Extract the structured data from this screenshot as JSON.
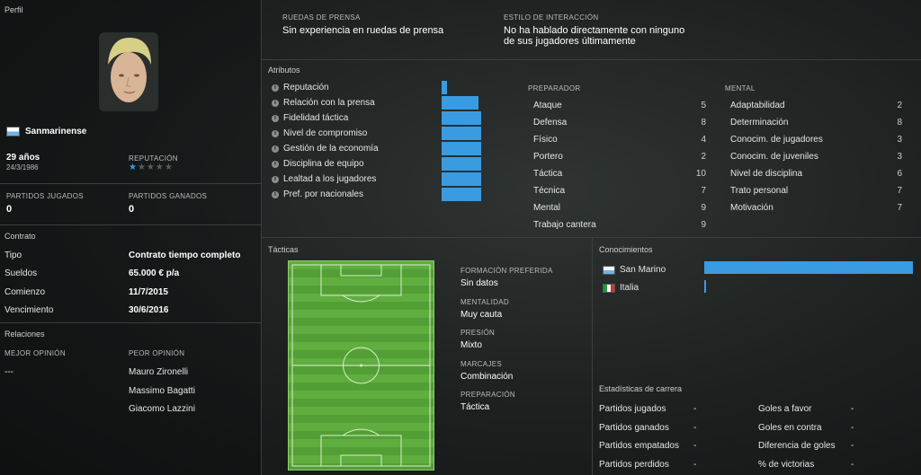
{
  "profile": {
    "section_title": "Perfil",
    "nationality": "Sanmarinense",
    "age": "29 años",
    "birth_date": "24/3/1986",
    "reputation_label": "REPUTACIÓN",
    "reputation_stars": 0.5,
    "reputation_stars_max": 5,
    "games_played_label": "PARTIDOS JUGADOS",
    "games_played": "0",
    "games_won_label": "PARTIDOS GANADOS",
    "games_won": "0"
  },
  "contract": {
    "section_title": "Contrato",
    "rows": [
      {
        "label": "Tipo",
        "value": "Contrato tiempo completo"
      },
      {
        "label": "Sueldos",
        "value": "65.000 € p/a"
      },
      {
        "label": "Comienzo",
        "value": "11/7/2015"
      },
      {
        "label": "Vencimiento",
        "value": "30/6/2016"
      }
    ]
  },
  "relations": {
    "section_title": "Relaciones",
    "best_label": "MEJOR OPINIÓN",
    "best_value": "---",
    "worst_label": "PEOR OPINIÓN",
    "worst": [
      "Mauro Zironelli",
      "Massimo Bagatti",
      "Giacomo Lazzini"
    ]
  },
  "press": {
    "label": "RUEDAS DE PRENSA",
    "value": "Sin experiencia en ruedas de prensa",
    "interaction_label": "ESTILO DE INTERACCIÓN",
    "interaction_value_line1": "No ha hablado directamente con ninguno",
    "interaction_value_line2": "de sus jugadores últimamente"
  },
  "attributes": {
    "section_title": "Atributos",
    "items": [
      {
        "label": "Reputación",
        "level": 0.12
      },
      {
        "label": "Relación con la prensa",
        "level": 0.9
      },
      {
        "label": "Fidelidad táctica",
        "level": 0.95
      },
      {
        "label": "Nivel de compromiso",
        "level": 0.95
      },
      {
        "label": "Gestión de la economía",
        "level": 0.95
      },
      {
        "label": "Disciplina de equipo",
        "level": 0.95
      },
      {
        "label": "Lealtad a los jugadores",
        "level": 0.95
      },
      {
        "label": "Pref. por nacionales",
        "level": 0.95
      }
    ]
  },
  "coach": {
    "title": "PREPARADOR",
    "rows": [
      {
        "label": "Ataque",
        "value": "5"
      },
      {
        "label": "Defensa",
        "value": "8"
      },
      {
        "label": "Físico",
        "value": "4"
      },
      {
        "label": "Portero",
        "value": "2"
      },
      {
        "label": "Táctica",
        "value": "10"
      },
      {
        "label": "Técnica",
        "value": "7"
      },
      {
        "label": "Mental",
        "value": "9"
      },
      {
        "label": "Trabajo cantera",
        "value": "9"
      }
    ]
  },
  "mental": {
    "title": "MENTAL",
    "rows": [
      {
        "label": "Adaptabilidad",
        "value": "2"
      },
      {
        "label": "Determinación",
        "value": "8"
      },
      {
        "label": "Conocim. de jugadores",
        "value": "3"
      },
      {
        "label": "Conocim. de juveniles",
        "value": "3"
      },
      {
        "label": "Nivel de disciplina",
        "value": "6"
      },
      {
        "label": "Trato personal",
        "value": "7"
      },
      {
        "label": "Motivación",
        "value": "7"
      }
    ]
  },
  "tactics": {
    "section_title": "Tácticas",
    "items": [
      {
        "label": "FORMACIÓN PREFERIDA",
        "value": "Sin datos"
      },
      {
        "label": "MENTALIDAD",
        "value": "Muy cauta"
      },
      {
        "label": "PRESIÓN",
        "value": "Mixto"
      },
      {
        "label": "MARCAJES",
        "value": "Combinación"
      },
      {
        "label": "PREPARACIÓN",
        "value": "Táctica"
      }
    ]
  },
  "knowledge": {
    "section_title": "Conocimientos",
    "items": [
      {
        "country": "San Marino",
        "level": 1.0
      },
      {
        "country": "Italia",
        "level": 0.01
      }
    ]
  },
  "career": {
    "section_title": "Estadísticas de carrera",
    "left": [
      {
        "label": "Partidos jugados",
        "value": "-"
      },
      {
        "label": "Partidos ganados",
        "value": "-"
      },
      {
        "label": "Partidos empatados",
        "value": "-"
      },
      {
        "label": "Partidos perdidos",
        "value": "-"
      }
    ],
    "right": [
      {
        "label": "Goles a favor",
        "value": "-"
      },
      {
        "label": "Goles en contra",
        "value": "-"
      },
      {
        "label": "Diferencia de goles",
        "value": "-"
      },
      {
        "label": "% de victorias",
        "value": "-"
      }
    ]
  },
  "colors": {
    "bar_blue": "#3a9be0",
    "pitch_green": "#5fae3f"
  }
}
